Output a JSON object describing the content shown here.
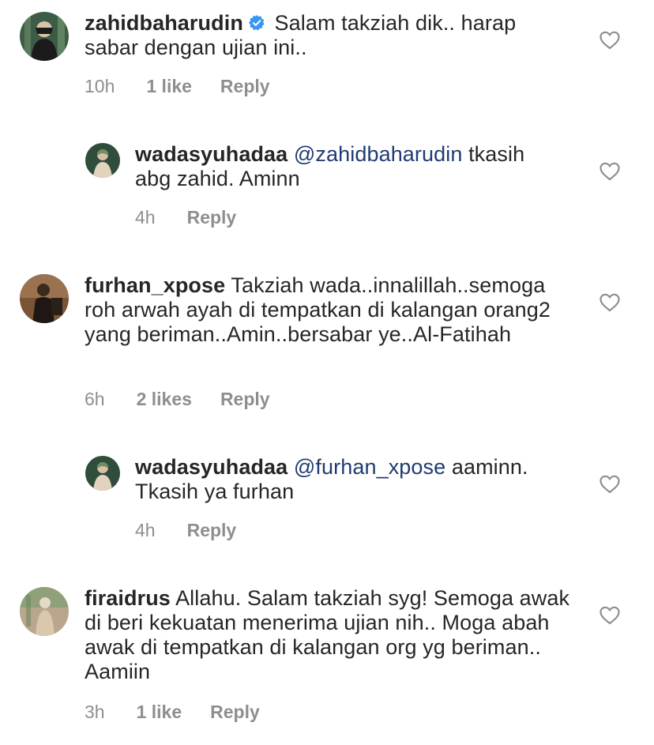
{
  "comments": [
    {
      "username": "zahidbaharudin",
      "verified": true,
      "mention": "",
      "text": "Salam takziah dik.. harap sabar dengan ujian ini..",
      "time": "10h",
      "likes": "1 like",
      "reply": "Reply",
      "avatar_color": "#2e4a3a"
    },
    {
      "username": "wadasyuhadaa",
      "verified": false,
      "mention": "@zahidbaharudin",
      "text": "tkasih abg zahid. Aminn",
      "time": "4h",
      "likes": "",
      "reply": "Reply",
      "avatar_color": "#2f4d3a"
    },
    {
      "username": "furhan_xpose",
      "verified": false,
      "mention": "",
      "text": "Takziah wada..innalillah..semoga roh arwah ayah di tempatkan di kalangan orang2 yang beriman..Amin..bersabar ye..Al-Fatihah",
      "time": "6h",
      "likes": "2 likes",
      "reply": "Reply",
      "avatar_color": "#5a3b22"
    },
    {
      "username": "wadasyuhadaa",
      "verified": false,
      "mention": "@furhan_xpose",
      "text": "aaminn. Tkasih ya furhan",
      "time": "4h",
      "likes": "",
      "reply": "Reply",
      "avatar_color": "#2f4d3a"
    },
    {
      "username": "firaidrus",
      "verified": false,
      "mention": "",
      "text": "Allahu. Salam takziah syg! Semoga awak di beri kekuatan menerima ujian nih.. Moga abah awak di tempatkan di kalangan org yg beriman.. Aamiin",
      "time": "3h",
      "likes": "1 like",
      "reply": "Reply",
      "avatar_color": "#c9b49a"
    }
  ],
  "colors": {
    "text": "#262626",
    "meta": "#8e8e8e",
    "mention": "#1f3b73",
    "verified": "#3897f0"
  }
}
